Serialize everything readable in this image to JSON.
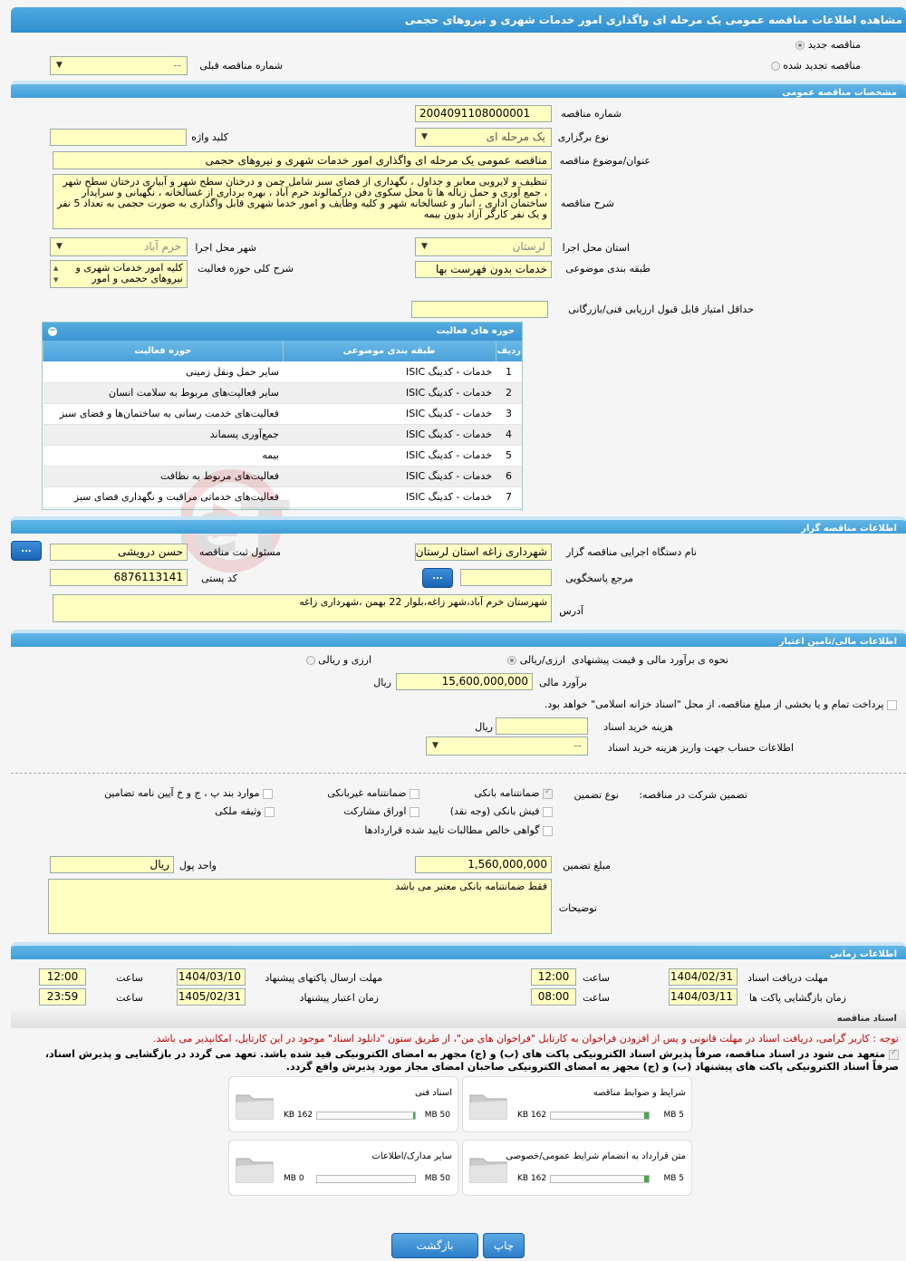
{
  "page_title": "مشاهده اطلاعات مناقصه عمومی یک مرحله ای واگذاری امور خدمات شهری و نیروهای حجمی",
  "top": {
    "new_tender": "مناقصه جدید",
    "renewed_tender": "مناقصه تجدید شده",
    "prev_tender_label": "شماره مناقصه قبلی",
    "prev_tender_value": "--"
  },
  "general": {
    "section": "مشخصات مناقصه عمومی",
    "number_label": "شماره مناقصه",
    "number": "2004091108000001",
    "type_label": "نوع برگزاری",
    "type": "یک مرحله ای",
    "keyword_label": "کلید واژه",
    "keyword": "",
    "subject_label": "عنوان/موضوع مناقصه",
    "subject": "مناقصه عمومی یک مرحله ای واگذاری امور خدمات شهری و نیروهای حجمی",
    "desc_label": "شرح مناقصه",
    "desc": "تنظیف و لایروبی معابر و جداول ، نگهداری از فضای سبز شامل چمن و درختان سطح شهر و آبیاری درختان سطح شهر ، جمع آوری و حمل زباله ها تا محل سکوی دفن درکمالوند خرم آباد ، بهره برداری از غسالخانه ، نگهبانی و سرایدار ساختمان اداری ، انبار و غسالخانه شهر و کلیه وظایف و امور خدما شهری قابل واگذاری به صورت حجمی  به تعداد 5 نفر و یک نفر کارگر آزاد بدون بیمه",
    "province_label": "استان محل اجرا",
    "province": "لرستان",
    "city_label": "شهر محل اجرا",
    "city": "خرم آباد",
    "category_label": "طبقه بندی موضوعی",
    "category": "خدمات بدون فهرست بها",
    "activity_label": "شرح کلی حوزه فعالیت",
    "activity": "کلیه امور خدمات شهری و نیروهای حجمی و امور",
    "min_score_label": "حداقل امتیاز قابل قبول ارزیابی فنی/بازرگانی",
    "min_score": ""
  },
  "activities": {
    "title": "حوزه های فعالیت",
    "headers": [
      "ردیف",
      "طبقه بندی موضوعی",
      "حوزه فعالیت"
    ],
    "rows": [
      [
        "1",
        "خدمات - کدینگ ISIC",
        "سایر حمل ونقل زمینی"
      ],
      [
        "2",
        "خدمات - کدینگ ISIC",
        "سایر فعالیت‌های مربوط به سلامت انسان"
      ],
      [
        "3",
        "خدمات - کدینگ ISIC",
        "فعالیت‌های خدمت رسانی به ساختمان‌ها و فضای سبز"
      ],
      [
        "4",
        "خدمات - کدینگ ISIC",
        "جمع‌آوری پسماند"
      ],
      [
        "5",
        "خدمات - کدینگ ISIC",
        "بیمه"
      ],
      [
        "6",
        "خدمات - کدینگ ISIC",
        "فعالیت‌های مربوط به نظافت"
      ],
      [
        "7",
        "خدمات - کدینگ ISIC",
        "فعالیت‌های خدماتی مراقبت و نگهداری فضای سبز"
      ]
    ]
  },
  "organizer": {
    "section": "اطلاعات مناقصه گزار",
    "org_label": "نام دستگاه اجرایی مناقصه گزار",
    "org": "شهرداری زاغه استان لرستان",
    "officer_label": "مسئول ثبت مناقصه",
    "officer": "حسن درویشی",
    "ref_label": "مرجع پاسخگویی",
    "ref": "",
    "postal_label": "کد پستی",
    "postal": "6876113141",
    "address_label": "آدرس",
    "address": "شهرستان خرم آباد،شهر زاغه،بلوار 22 بهمن ،شهرداری زاغه",
    "dots": "..."
  },
  "finance": {
    "section": "اطلاعات مالی/تامین اعتبار",
    "estimate_method_label": "نحوه ی برآورد مالی و قیمت پیشنهادی",
    "opt_rial_currency": "ارزی/ریالی",
    "opt_currency_and_rial": "ارزی و ریالی",
    "estimate_label": "برآورد مالی",
    "estimate": "15,600,000,000",
    "rial": "ریال",
    "treasury_text": "پرداخت تمام و یا بخشی از مبلغ مناقصه، از محل \"اسناد خزانه اسلامی\" خواهد بود.",
    "doc_cost_label": "هزینه خرید اسناد",
    "doc_cost": "",
    "account_label": "اطلاعات حساب جهت واریز هزینه خرید اسناد",
    "account": "--"
  },
  "guarantee": {
    "label": "تضمین شرکت در مناقصه:",
    "type_label": "نوع تضمین",
    "bank_guarantee": "ضمانتنامه بانکی",
    "nonbank_guarantee": "ضمانتنامه غیربانکی",
    "bylaw_items": "موارد بند پ ، ج و خ آیین نامه تضامین",
    "bank_receipt": "فیش بانکی (وجه نقد)",
    "bonds": "اوراق مشارکت",
    "property": "وثیقه ملکی",
    "claims_cert": "گواهی خالص مطالبات تایید شده قراردادها",
    "amount_label": "مبلغ تضمین",
    "amount": "1,560,000,000",
    "currency_label": "واحد پول",
    "currency": "ریال",
    "notes_label": "توضیحات",
    "notes": "فقط ضمانتنامه بانکی معتبر می باشد"
  },
  "timing": {
    "section": "اطلاعات زمانی",
    "doc_receive_label": "مهلت دریافت اسناد",
    "doc_receive_date": "1404/02/31",
    "doc_receive_time": "12:00",
    "submit_label": "مهلت ارسال پاکتهای پیشنهاد",
    "submit_date": "1404/03/10",
    "submit_time": "12:00",
    "open_label": "زمان بازگشایی پاکت ها",
    "open_date": "1404/03/11",
    "open_time": "08:00",
    "validity_label": "زمان اعتبار پیشنهاد",
    "validity_date": "1405/02/31",
    "validity_time": "23:59",
    "time_label": "ساعت"
  },
  "documents": {
    "section": "اسناد مناقصه",
    "notice": "توجه : کاربر گرامی، دریافت اسناد در مهلت قانونی و پس از افزودن فراخوان به کارتابل \"فراخوان های من\"، از طریق ستون \"دانلود اسناد\" موجود در این کارتابل، امکانپذیر می باشد.",
    "commit_line1": "متعهد می شود در اسناد مناقصه، صرفاً پذیرش اسناد الکترونیکی پاکت های (ب) و (ج) مجهز به امضای الکترونیکی قید شده باشد. تعهد می گردد در بازگشایی و پذیرش اسناد،",
    "commit_line2": "صرفاً اسناد الکترونیکی پاکت های پیشنهاد (ب) و (ج) مجهز به امضای الکترونیکی صاحبان امضای مجاز مورد پذیرش واقع گردد.",
    "files": [
      {
        "name": "شرایط و ضوابط مناقصه",
        "size": "162 KB",
        "max": "5 MB",
        "fill": 0.05
      },
      {
        "name": "اسناد فنی",
        "size": "162 KB",
        "max": "50 MB",
        "fill": 0.02
      },
      {
        "name": "متن قرارداد به انضمام شرایط عمومی/خصوصی",
        "size": "162 KB",
        "max": "5 MB",
        "fill": 0.05
      },
      {
        "name": "سایر مدارک/اطلاعات",
        "size": "0 MB",
        "max": "50 MB",
        "fill": 0
      }
    ]
  },
  "buttons": {
    "print": "چاپ",
    "back": "بازگشت"
  },
  "watermark": "AriaTender.neT",
  "colors": {
    "header": "#3f9fd8",
    "field": "#ffffc2",
    "red": "#cc0000"
  }
}
